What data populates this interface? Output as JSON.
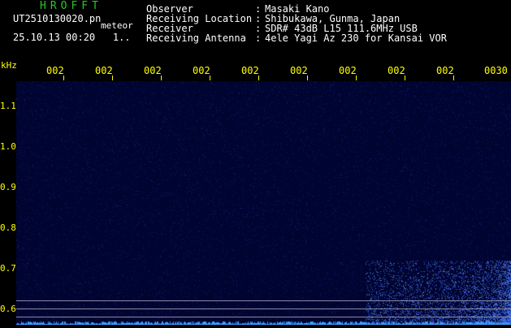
{
  "header": {
    "title": "HROFFT",
    "file_name": "UT2510130020.pn",
    "file_ext": "meteor",
    "datetime": "25.10.13 00:20",
    "datetime_suffix": "1..",
    "info": [
      {
        "label": "Observer",
        "value": "Masaki Kano"
      },
      {
        "label": "Receiving Location",
        "value": "Shibukawa, Gunma, Japan"
      },
      {
        "label": "Receiver",
        "value": "SDR# 43dB L15 111.6MHz USB"
      },
      {
        "label": "Receiving Antenna",
        "value": "4ele Yagi Az 230 for Kansai VOR"
      }
    ]
  },
  "y_axis": {
    "unit": "kHz",
    "ticks": [
      "1.1",
      "1.0",
      "0.9",
      "0.8",
      "0.7",
      "0.6"
    ]
  },
  "x_axis": {
    "ticks": [
      "002",
      "002",
      "002",
      "002",
      "002",
      "002",
      "002",
      "002",
      "002",
      "0030"
    ]
  },
  "colors": {
    "background": "#000000",
    "plot_background": "#000430",
    "axis_text": "#ffff00",
    "title": "#22cc22",
    "signal": "#3aa0ff"
  }
}
